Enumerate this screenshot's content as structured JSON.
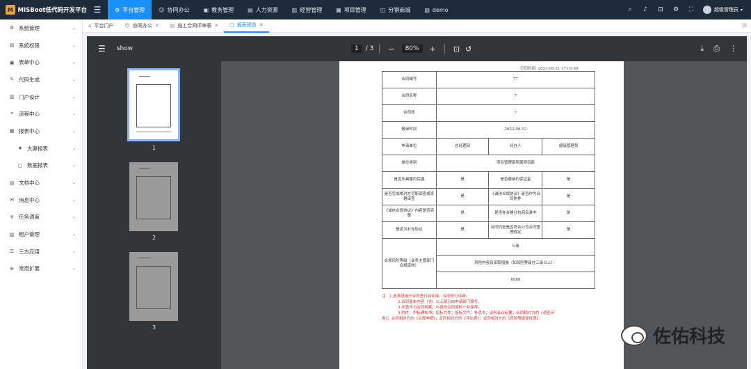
{
  "app": {
    "title": "MISBoot低代码开发平台"
  },
  "topnav": [
    {
      "icon": "⚙",
      "label": "平台管理",
      "active": true
    },
    {
      "icon": "☺",
      "label": "协同办公"
    },
    {
      "icon": "▣",
      "label": "教务管理"
    },
    {
      "icon": "▤",
      "label": "人力资源"
    },
    {
      "icon": "▥",
      "label": "经营管理"
    },
    {
      "icon": "▦",
      "label": "项目管理"
    },
    {
      "icon": "◫",
      "label": "分销商城"
    },
    {
      "icon": "▧",
      "label": "demo"
    }
  ],
  "user": {
    "name": "超级管理员"
  },
  "sidebar": [
    {
      "icon": "⚙",
      "label": "系统管理",
      "sub": false
    },
    {
      "icon": "▤",
      "label": "系统权限",
      "sub": false
    },
    {
      "icon": "▣",
      "label": "表单中心",
      "sub": false
    },
    {
      "icon": "✎",
      "label": "代码生成",
      "sub": false
    },
    {
      "icon": "▥",
      "label": "门户设计",
      "sub": false
    },
    {
      "icon": "⌗",
      "label": "流程中心",
      "sub": false
    },
    {
      "icon": "▦",
      "label": "报表中心",
      "sub": false
    },
    {
      "icon": "♦",
      "label": "大屏报表",
      "sub": true
    },
    {
      "icon": "▢",
      "label": "数据报表",
      "sub": true
    },
    {
      "icon": "▤",
      "label": "文档中心",
      "sub": false
    },
    {
      "icon": "✉",
      "label": "消息中心",
      "sub": false
    },
    {
      "icon": "♆",
      "label": "任务调度",
      "sub": false
    },
    {
      "icon": "▧",
      "label": "租户管理",
      "sub": false
    },
    {
      "icon": "☰",
      "label": "三方应用",
      "sub": false
    },
    {
      "icon": "⊕",
      "label": "常用扩展",
      "sub": false
    }
  ],
  "tabs": [
    {
      "label": "平台门户",
      "closable": false,
      "active": false
    },
    {
      "label": "协同办公",
      "closable": true,
      "active": false
    },
    {
      "label": "施工合同评审表",
      "closable": true,
      "active": false
    },
    {
      "label": "报表预览",
      "closable": true,
      "active": true
    }
  ],
  "viewer": {
    "title": "show",
    "page": "1",
    "total": "/ 3",
    "zoom": "80%",
    "thumb_labels": [
      "1",
      "2",
      "3"
    ]
  },
  "doc": {
    "print_time": "打印时间:    2023-09-21 17:01:48",
    "rows": {
      "contract_no": {
        "label": "合同编号",
        "value": "77"
      },
      "contract_name": {
        "label": "合同名称",
        "value": "7"
      },
      "contract_stage": {
        "label": "合同段",
        "value": "7"
      },
      "report_time": {
        "label": "报审时间",
        "value": "2023-09-12"
      },
      "apply_unit": {
        "label": "申请单位",
        "v1": "总经理部",
        "v2": "经办人",
        "v3": "超级管理员"
      },
      "unit_type": {
        "label": "单位类别",
        "value": "项目管理部所属项目部"
      },
      "perf_bond": {
        "label": "是否出具履约保函",
        "v1": "是",
        "label2": "是否缴纳约保证金",
        "v2": "是"
      },
      "due_diligence": {
        "label": "是否完成相对方尽职调查或资格审查",
        "v1": "是",
        "label2": "《诚信合规协议》是否作为合同附件",
        "v2": "是"
      },
      "integrity": {
        "label": "《诚信合规协议》内容是否完整",
        "v1": "是",
        "label2": "是否在合格分包商名录中",
        "v2": "是"
      },
      "supplement": {
        "label": "是否为补充协议",
        "v1": "是",
        "label2": "合同约定是否符合公司合同管理规定",
        "v2": "是"
      },
      "risk": {
        "label": "合规风险等级（业务主管部门合规审核）",
        "level": "三级",
        "measures_label": "风险内容及采取措施（如风险等级在三级以上）：",
        "measures": "8888"
      }
    },
    "notes": [
      "注：1.此表适用于合同签订前评审、合同修订评审。",
      "2.合同基本内容（含）以上部分由申请部门填写。",
      "3.本表作为合同档案，与该份合同资料一并保存。",
      "4.附件：中标通知书；招标文件；投标文件；补遗书；谈判会议纪要；合同相对方的《调查问",
      "卷》；合同相对方的《合规申明》；合同相对方的《评估表》；合同相对方的《风险等级审批表》。"
    ]
  },
  "watermark": {
    "text": "佐佑科技"
  },
  "colors": {
    "topbar": "#1d2b3a",
    "accent": "#1890ff",
    "viewer_bg": "#525659",
    "notes": "#d03030"
  }
}
